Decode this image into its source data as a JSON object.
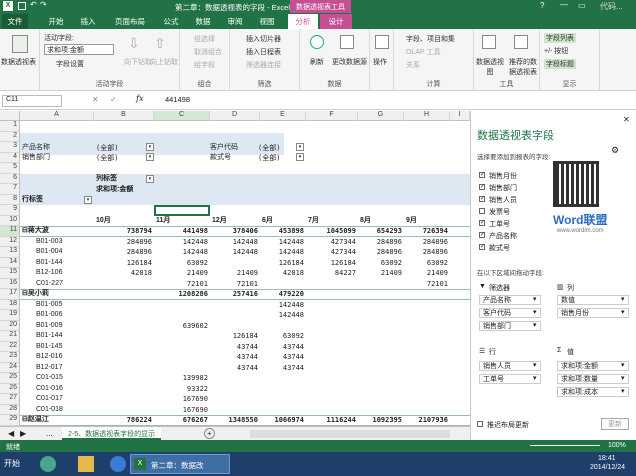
{
  "window": {
    "title": "第二章：数据透视表的字段 - Excel",
    "context_title": "数据透视表工具",
    "watermark": "代码..."
  },
  "tabs": [
    "文件",
    "开始",
    "插入",
    "页面布局",
    "公式",
    "数据",
    "审阅",
    "视图",
    "分析",
    "设计"
  ],
  "ribbon": {
    "pivot_group": "数据透视表",
    "active_field_label": "活动字段:",
    "active_field_value": "求和项:金额",
    "field_settings": "字段设置",
    "drill_down": "向下钻取",
    "drill_up": "向上钻取",
    "active_field_group": "活动字段",
    "group_sel": "组选择",
    "ungroup": "取消组合",
    "group_field": "组字段",
    "group_label": "组合",
    "slicer": "插入切片器",
    "timeline": "插入日程表",
    "filter_conn": "筛选器连接",
    "filter_label": "筛选",
    "refresh": "刷新",
    "change_source": "更改数据源",
    "data_label": "数据",
    "actions": "操作",
    "fields_items": "字段、项目和集",
    "olap": "OLAP 工具",
    "relations": "关系",
    "calc_label": "计算",
    "pivot_chart": "数据透视图",
    "recommended": "推荐的数据透视表",
    "tools_label": "工具",
    "field_list": "字段列表",
    "plus_minus": "+/- 按钮",
    "field_headers": "字段标题",
    "show_label": "显示"
  },
  "formula": {
    "namebox": "C11",
    "fx": "fx",
    "value": "441498"
  },
  "columns": [
    "A",
    "B",
    "C",
    "D",
    "E",
    "F",
    "G",
    "H",
    "I"
  ],
  "rows": [
    "1",
    "2",
    "3",
    "4",
    "5",
    "6",
    "7",
    "8",
    "9",
    "10",
    "11",
    "12",
    "13",
    "14",
    "15",
    "16",
    "17",
    "18",
    "19",
    "20",
    "21",
    "22",
    "23",
    "24",
    "25",
    "26",
    "27",
    "28",
    "29"
  ],
  "filters": {
    "product_label": "产品名称",
    "product_value": "(全部)",
    "dept_label": "销售部门",
    "dept_value": "(全部)",
    "cust_label": "客户代码",
    "cust_value": "(全部)",
    "style_label": "款式号",
    "style_value": "(全部)"
  },
  "pivot": {
    "col_label": "列标签",
    "sum_label": "求和项:金额",
    "row_label": "行标签",
    "months": [
      "10月",
      "11月",
      "12月",
      "6月",
      "7月",
      "8月",
      "9月"
    ],
    "rows": [
      {
        "name": "⊟蒋大波",
        "bold": true,
        "vals": [
          "738794",
          "441498",
          "378406",
          "453898",
          "1045099",
          "654293",
          "726394"
        ]
      },
      {
        "name": "B01-003",
        "vals": [
          "284896",
          "142448",
          "142448",
          "142448",
          "427344",
          "284896",
          "284896"
        ]
      },
      {
        "name": "B01-004",
        "vals": [
          "284896",
          "142448",
          "142448",
          "142448",
          "427344",
          "284896",
          "284896"
        ]
      },
      {
        "name": "B01-144",
        "vals": [
          "126184",
          "63092",
          "",
          "126184",
          "126184",
          "63092",
          "63092"
        ]
      },
      {
        "name": "B12-106",
        "vals": [
          "42818",
          "21409",
          "21409",
          "42818",
          "84227",
          "21409",
          "21409"
        ]
      },
      {
        "name": "C01-227",
        "vals": [
          "",
          "72101",
          "72101",
          "",
          "",
          "",
          "72101"
        ]
      },
      {
        "name": "⊟吴小莉",
        "bold": true,
        "vals": [
          "",
          "1208286",
          "257416",
          "479220",
          "",
          "",
          ""
        ]
      },
      {
        "name": "B01-005",
        "vals": [
          "",
          "",
          "",
          "142448",
          "",
          "",
          ""
        ]
      },
      {
        "name": "B01-006",
        "vals": [
          "",
          "",
          "",
          "142448",
          "",
          "",
          ""
        ]
      },
      {
        "name": "B01-009",
        "vals": [
          "",
          "639602",
          "",
          "",
          "",
          "",
          ""
        ]
      },
      {
        "name": "B01-144",
        "vals": [
          "",
          "",
          "126184",
          "63092",
          "",
          "",
          ""
        ]
      },
      {
        "name": "B01-145",
        "vals": [
          "",
          "",
          "43744",
          "43744",
          "",
          "",
          ""
        ]
      },
      {
        "name": "B12-016",
        "vals": [
          "",
          "",
          "43744",
          "43744",
          "",
          "",
          ""
        ]
      },
      {
        "name": "B12-017",
        "vals": [
          "",
          "",
          "43744",
          "43744",
          "",
          "",
          ""
        ]
      },
      {
        "name": "C01-015",
        "vals": [
          "",
          "139982",
          "",
          "",
          "",
          "",
          ""
        ]
      },
      {
        "name": "C01-016",
        "vals": [
          "",
          "93322",
          "",
          "",
          "",
          "",
          ""
        ]
      },
      {
        "name": "C01-017",
        "vals": [
          "",
          "167690",
          "",
          "",
          "",
          "",
          ""
        ]
      },
      {
        "name": "C01-018",
        "vals": [
          "",
          "167690",
          "",
          "",
          "",
          "",
          ""
        ]
      },
      {
        "name": "⊟赵温江",
        "bold": true,
        "vals": [
          "786224",
          "676267",
          "1348550",
          "1066974",
          "1116244",
          "1092395",
          "2107936"
        ]
      }
    ]
  },
  "sheetbar": {
    "tab": "2-5、数据透视表字段的显示",
    "dots": "..."
  },
  "status": {
    "ready": "就绪",
    "zoom": "100%"
  },
  "pane": {
    "title": "数据透视表字段",
    "choose": "选择要添加到报表的字段:",
    "fields": [
      {
        "name": "销售月份",
        "checked": true
      },
      {
        "name": "销售部门",
        "checked": true
      },
      {
        "name": "销售人员",
        "checked": true
      },
      {
        "name": "发票号",
        "checked": false
      },
      {
        "name": "工单号",
        "checked": true
      },
      {
        "name": "产品名称",
        "checked": true
      },
      {
        "name": "款式号",
        "checked": true
      }
    ],
    "drag": "在以下区域间拖动字段:",
    "filter_area": "筛选器",
    "col_area": "列",
    "row_area": "行",
    "val_area": "值",
    "filter_items": [
      "产品名称",
      "客户代码",
      "销售部门"
    ],
    "col_items": [
      "数值",
      "销售月份"
    ],
    "row_items": [
      "销售人员",
      "工单号"
    ],
    "val_items": [
      "求和项:金额",
      "求和项:数量",
      "求和项:成本"
    ],
    "defer": "推迟布局更新",
    "update": "更新",
    "logo": "Word联盟",
    "site": "www.wordlm.com"
  },
  "taskbar": {
    "start": "开始",
    "app": "第二章：数据改",
    "time": "18:41",
    "date": "2014/12/24"
  }
}
